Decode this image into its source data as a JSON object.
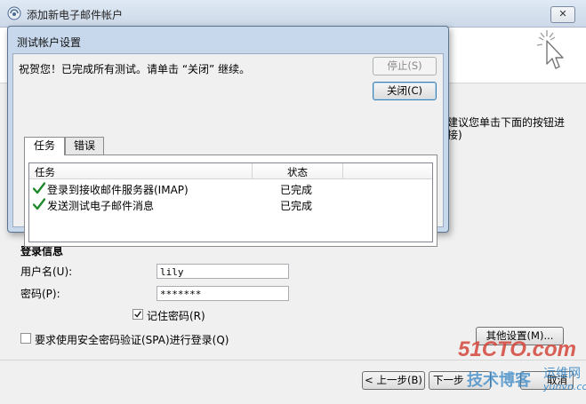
{
  "main_window": {
    "title": "添加新电子邮件帐户",
    "close_label": "✕",
    "side_text_line1": "建议您单击下面的按钮进",
    "side_text_line2": "接)",
    "login_section_title": "登录信息",
    "username_label": "用户名(U):",
    "username_value": "lily",
    "password_label": "密码(P):",
    "password_value": "*******",
    "remember_password_label": "记住密码(R)",
    "remember_password_checked": true,
    "spa_label": "要求使用安全密码验证(SPA)进行登录(Q)",
    "spa_checked": false,
    "more_settings_label": "其他设置(M)...",
    "back_label": "< 上一步(B)",
    "next_label": "下一步",
    "cancel_label": "取消"
  },
  "dialog": {
    "title": "测试帐户设置",
    "message": "祝贺您！已完成所有测试。请单击 “关闭” 继续。",
    "stop_label": "停止(S)",
    "close_label": "关闭(C)",
    "tabs": [
      {
        "label": "任务",
        "active": true
      },
      {
        "label": "错误",
        "active": false
      }
    ],
    "columns": {
      "task": "任务",
      "status": "状态"
    },
    "rows": [
      {
        "task": "登录到接收邮件服务器(IMAP)",
        "status": "已完成"
      },
      {
        "task": "发送测试电子邮件消息",
        "status": "已完成"
      }
    ]
  },
  "watermark": {
    "text1": "51CTO.com",
    "text2": "技术博客",
    "text3": "运维网",
    "text4": "yunvn.com"
  },
  "colors": {
    "check_green": "#1f8a2c",
    "dialog_frame": "#c7d8ec",
    "watermark_red": "#d4463a",
    "watermark_blue": "#2d7fc1"
  }
}
